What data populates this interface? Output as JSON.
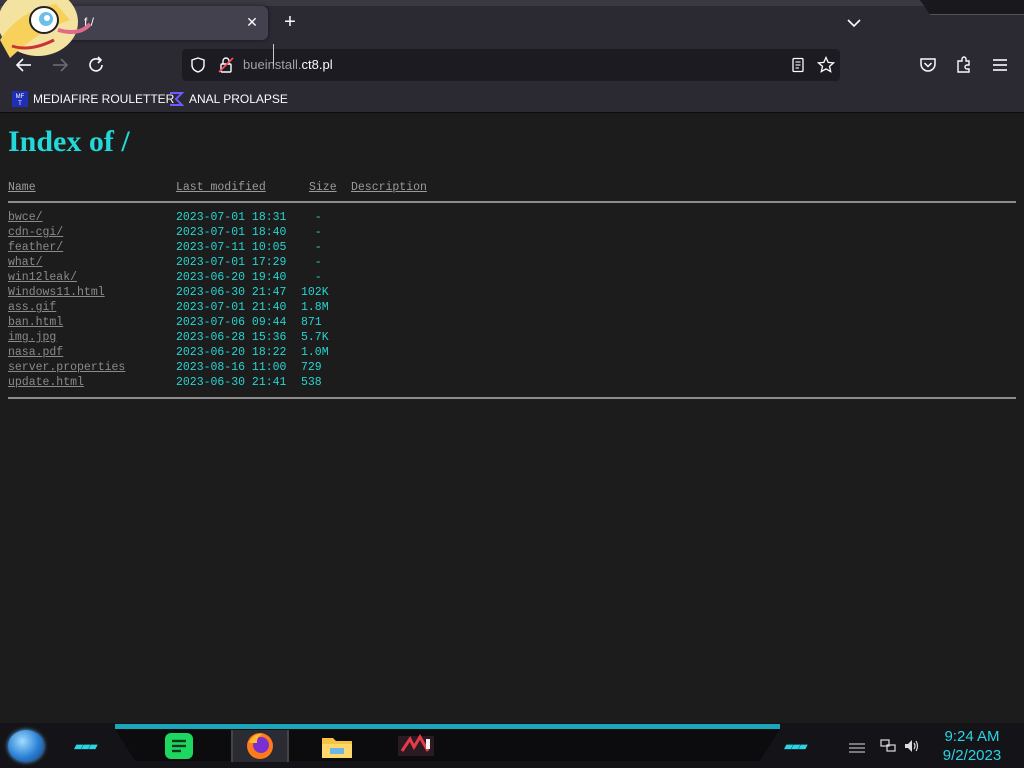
{
  "browser": {
    "tab": {
      "title": "f /"
    },
    "url": {
      "subdomain": "bueinstall.",
      "domain": "ct8.pl"
    },
    "bookmarks": [
      {
        "label": "MEDIAFIRE ROULETTER",
        "icon": "mediafire-icon"
      },
      {
        "label": "ANAL PROLAPSE",
        "icon": "sigma-icon"
      }
    ]
  },
  "page": {
    "heading": "Index of /",
    "columns": {
      "name": "Name",
      "last_modified": "Last modified",
      "size": "Size",
      "description": "Description"
    },
    "rows": [
      {
        "name": "bwce/",
        "date": "2023-07-01 18:31",
        "size": "  -"
      },
      {
        "name": "cdn-cgi/",
        "date": "2023-07-01 18:40",
        "size": "  -"
      },
      {
        "name": "feather/",
        "date": "2023-07-11 10:05",
        "size": "  -"
      },
      {
        "name": "what/",
        "date": "2023-07-01 17:29",
        "size": "  -"
      },
      {
        "name": "win12leak/",
        "date": "2023-06-20 19:40",
        "size": "  -"
      },
      {
        "name": "Windows11.html",
        "date": "2023-06-30 21:47",
        "size": "102K"
      },
      {
        "name": "ass.gif",
        "date": "2023-07-01 21:40",
        "size": "1.8M"
      },
      {
        "name": "ban.html",
        "date": "2023-07-06 09:44",
        "size": "871"
      },
      {
        "name": "img.jpg",
        "date": "2023-06-28 15:36",
        "size": "5.7K"
      },
      {
        "name": "nasa.pdf",
        "date": "2023-06-20 18:22",
        "size": "1.0M"
      },
      {
        "name": "server.properties",
        "date": "2023-08-16 11:00",
        "size": "729"
      },
      {
        "name": "update.html",
        "date": "2023-06-30 21:41",
        "size": "538"
      }
    ]
  },
  "taskbar": {
    "apps": [
      "spotify-icon",
      "firefox-icon",
      "file-explorer-icon",
      "game-app-icon"
    ],
    "clock": {
      "time": "9:24 AM",
      "date": "9/2/2023"
    },
    "accent": "#2ad4e4"
  }
}
